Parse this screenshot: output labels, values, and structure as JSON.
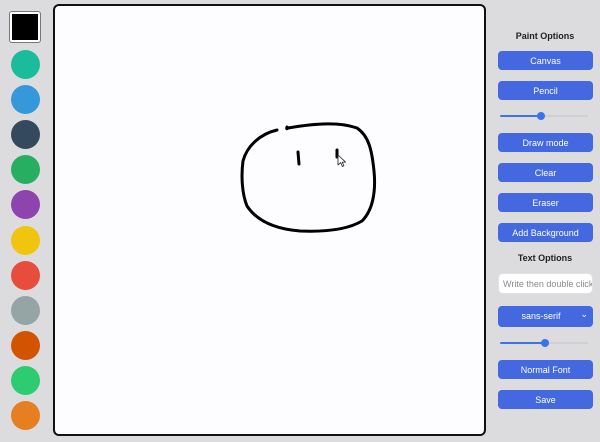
{
  "palette": {
    "selected_index": 0,
    "colors": [
      "#000000",
      "#1abc9c",
      "#3498db",
      "#34495e",
      "#27ae60",
      "#8e44ad",
      "#f1c40f",
      "#e74c3c",
      "#95a5a6",
      "#d35400",
      "#2ecc71",
      "#e67e22"
    ]
  },
  "paint_options": {
    "heading": "Paint Options",
    "canvas_label": "Canvas",
    "pencil_label": "Pencil",
    "brush_size_level": 0.47,
    "draw_mode_label": "Draw mode",
    "clear_label": "Clear",
    "eraser_label": "Eraser",
    "add_background_label": "Add Background"
  },
  "text_options": {
    "heading": "Text Options",
    "text_input_placeholder": "Write then double click",
    "font_family_selected": "sans-serif",
    "font_size_level": 0.51,
    "font_weight_label": "Normal Font",
    "save_label": "Save"
  },
  "colors": {
    "button_bg": "#4468e0",
    "slider_accent": "#3b73e8",
    "canvas_bg": "#fdfcff",
    "stroke": "#000000"
  },
  "icons": {
    "cursor": "arrow-cursor-icon",
    "dropdown": "chevron-down-icon"
  }
}
